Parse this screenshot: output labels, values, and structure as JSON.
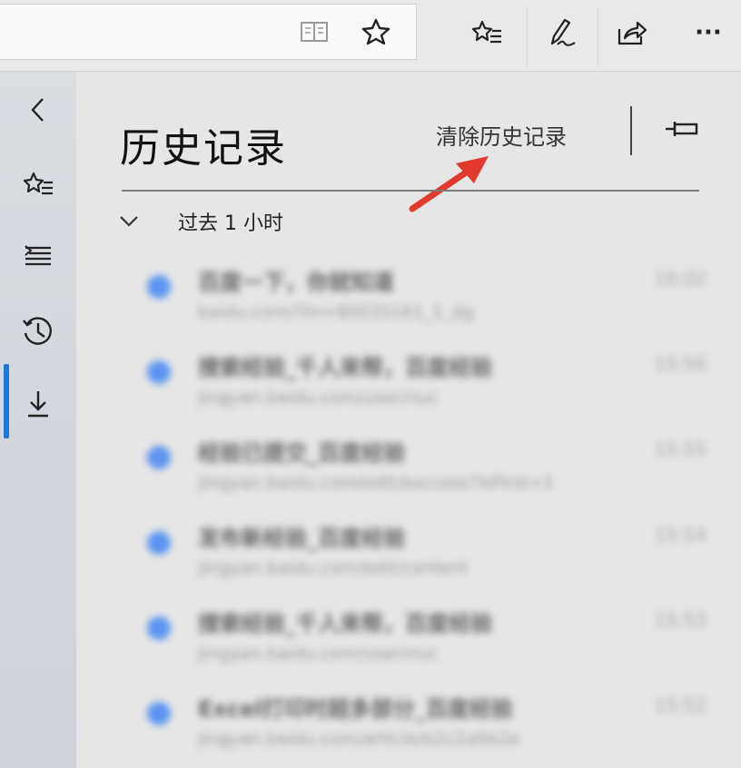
{
  "toolbar": {
    "icons": [
      "reading-view-icon",
      "favorite-star-icon",
      "favorites-hub-icon",
      "pen-note-icon",
      "share-icon",
      "more-icon"
    ],
    "more_label": "···"
  },
  "rail": {
    "items": [
      "back-chevron-icon",
      "favorites-icon",
      "reading-list-icon",
      "history-icon",
      "downloads-icon"
    ],
    "active": "history-icon"
  },
  "panel": {
    "title": "历史记录",
    "clear_history": "清除历史记录",
    "group_label": "过去 1 小时"
  },
  "history": [
    {
      "title": "百度一下，你就知道",
      "url": "baidu.com/?tn=80035161_1_dg",
      "time": "16:02"
    },
    {
      "title": "搜索经验_千人来帮，百度经验",
      "url": "jingyan.baidu.com/user/nuc",
      "time": "15:56"
    },
    {
      "title": "经验已提交_百度经验",
      "url": "jingyan.baidu.com/edit/success?isFirst=1",
      "time": "15:55"
    },
    {
      "title": "发布新经验_百度经验",
      "url": "jingyan.baidu.com/edit/content",
      "time": "15:54"
    },
    {
      "title": "搜索经验_千人来帮，百度经验",
      "url": "jingyan.baidu.com/user/nuc",
      "time": "15:53"
    },
    {
      "title": "Excel打印时超多部分_百度经验",
      "url": "jingyan.baidu.com/article/b2c2a5b2e",
      "time": "15:52"
    }
  ],
  "colors": {
    "accent": "#1e78d7",
    "arrow": "#e23a2d",
    "favicon": "#5b95f0"
  }
}
